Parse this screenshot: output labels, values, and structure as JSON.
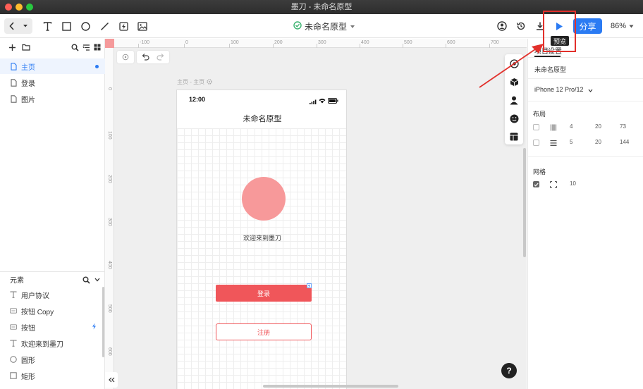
{
  "window": {
    "title": "墨刀 - 未命名原型"
  },
  "toolbar": {
    "project_title": "未命名原型",
    "share_label": "分享",
    "zoom_level": "86%",
    "preview_tooltip": "预览"
  },
  "pages_panel": {
    "pages": [
      {
        "label": "主页",
        "active": true
      },
      {
        "label": "登录",
        "active": false
      },
      {
        "label": "图片",
        "active": false
      }
    ]
  },
  "elements_panel": {
    "title": "元素",
    "items": [
      {
        "icon": "text-icon",
        "label": "用户协议"
      },
      {
        "icon": "button-icon",
        "label": "按钮 Copy"
      },
      {
        "icon": "button-icon",
        "label": "按钮"
      },
      {
        "icon": "text-icon",
        "label": "欢迎来到墨刀"
      },
      {
        "icon": "circle-icon",
        "label": "圆形"
      },
      {
        "icon": "rect-icon",
        "label": "矩形"
      }
    ]
  },
  "rulers": {
    "h_ticks": [
      "-100",
      "0",
      "100",
      "200",
      "300",
      "400",
      "500",
      "600",
      "700"
    ],
    "v_ticks": [
      "0",
      "100",
      "200",
      "300",
      "400",
      "500",
      "600"
    ]
  },
  "canvas": {
    "frame_label": "主页 - 主页",
    "phone": {
      "time": "12:00",
      "title": "未命名原型",
      "welcome_text": "欢迎来到墨刀",
      "login_label": "登录",
      "register_label": "注册"
    },
    "help_label": "?"
  },
  "inspector": {
    "tab_project": "项目",
    "tab_settings": "设置",
    "project_name": "未命名原型",
    "device": "iPhone 12 Pro/12",
    "layout_title": "布局",
    "layout_rows": [
      {
        "count": "4",
        "gutter": "20",
        "margin": "73"
      },
      {
        "count": "5",
        "gutter": "20",
        "margin": "144"
      }
    ],
    "grid_title": "网格",
    "grid_size": "10"
  },
  "colors": {
    "accent": "#2b7bf3",
    "primary_red": "#f0565a",
    "circle": "#f7999a",
    "highlight": "#e2302b"
  }
}
